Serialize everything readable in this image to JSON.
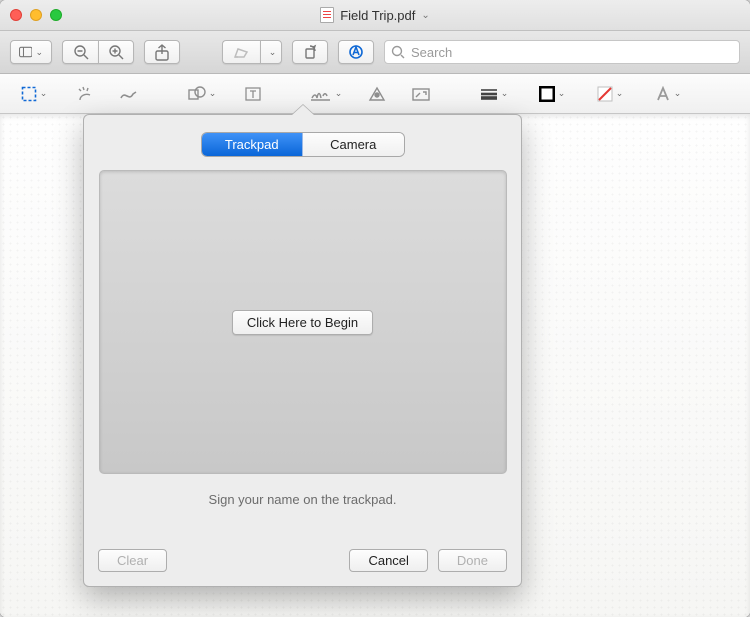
{
  "window": {
    "title": "Field Trip.pdf"
  },
  "search": {
    "placeholder": "Search"
  },
  "popover": {
    "tabs": {
      "trackpad": "Trackpad",
      "camera": "Camera"
    },
    "begin_label": "Click Here to Begin",
    "hint": "Sign your name on the trackpad.",
    "clear_label": "Clear",
    "cancel_label": "Cancel",
    "done_label": "Done"
  }
}
